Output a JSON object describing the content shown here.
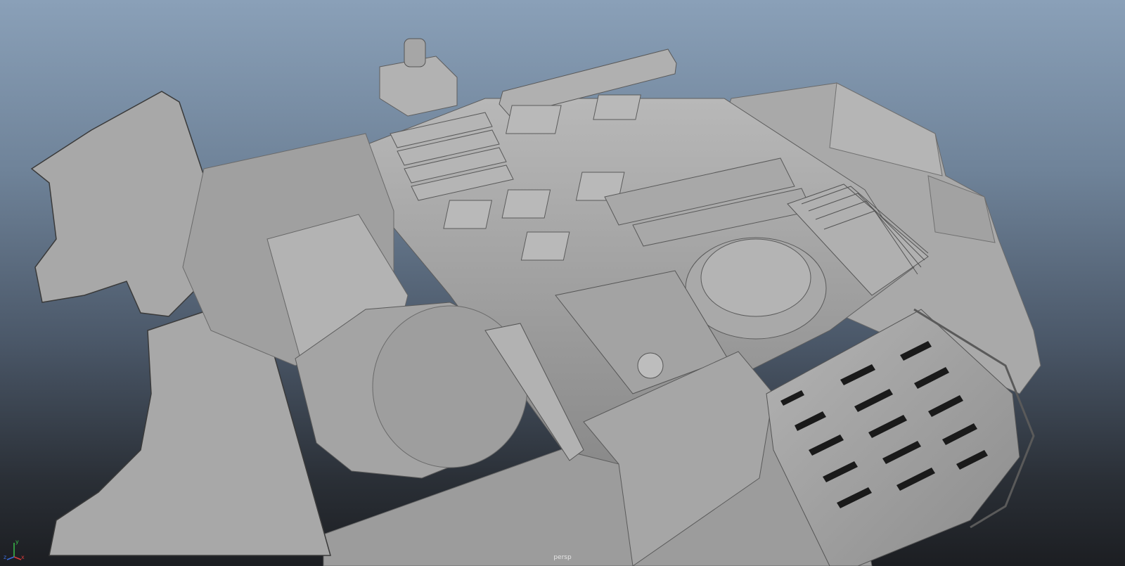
{
  "viewport": {
    "camera_label": "persp",
    "background_top": "#8aa0b8",
    "background_bottom": "#1c1e22",
    "shaded_gray": "#a6a6a6"
  },
  "axis_gizmo": {
    "x_label": "x",
    "y_label": "y",
    "z_label": "z",
    "x_color": "#d83a3a",
    "y_color": "#3ac04a",
    "z_color": "#3a6ad8"
  }
}
